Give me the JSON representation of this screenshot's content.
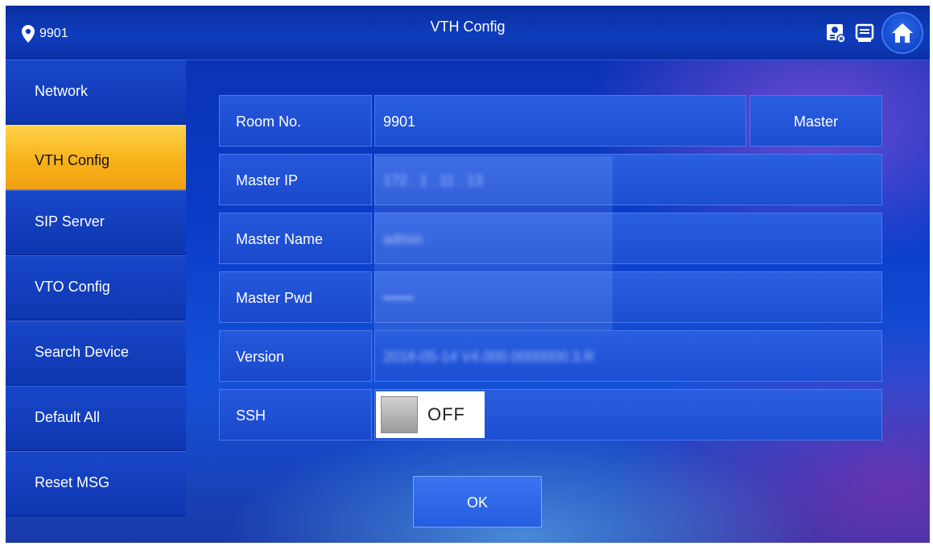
{
  "header": {
    "location_icon": "location-pin-icon",
    "location_label": "9901",
    "title": "VTH Config",
    "icons": [
      "contact-card-icon",
      "message-board-icon",
      "home-icon"
    ]
  },
  "sidebar": {
    "items": [
      {
        "label": "Network",
        "active": false
      },
      {
        "label": "VTH Config",
        "active": true
      },
      {
        "label": "SIP Server",
        "active": false
      },
      {
        "label": "VTO Config",
        "active": false
      },
      {
        "label": "Search Device",
        "active": false
      },
      {
        "label": "Default All",
        "active": false
      },
      {
        "label": "Reset MSG",
        "active": false
      }
    ]
  },
  "form": {
    "room_no": {
      "label": "Room No.",
      "value": "9901"
    },
    "master_button": "Master",
    "master_ip": {
      "label": "Master IP",
      "value": "172 . 1 . 11 . 13"
    },
    "master_name": {
      "label": "Master Name",
      "value": "admin"
    },
    "master_pwd": {
      "label": "Master Pwd",
      "value": "••••••"
    },
    "version": {
      "label": "Version",
      "value": "2018-05-14 V4.000.0000000.3.R"
    },
    "ssh": {
      "label": "SSH",
      "state": "OFF"
    }
  },
  "ok_button": "OK",
  "colors": {
    "active_tab": "#f8b21a",
    "background": "#0a3cc8"
  }
}
